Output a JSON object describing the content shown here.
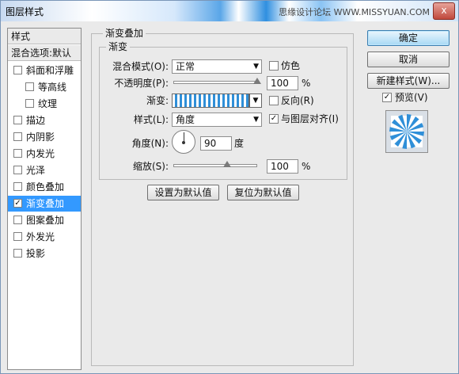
{
  "window": {
    "title": "图层样式",
    "watermark": "思缘设计论坛 WWW.MISSYUAN.COM",
    "close": "x"
  },
  "sidebar": {
    "header": "样式",
    "blend_options": "混合选项:默认",
    "items": [
      {
        "label": "斜面和浮雕",
        "checked": false,
        "indent": false,
        "selected": false
      },
      {
        "label": "等高线",
        "checked": false,
        "indent": true,
        "selected": false
      },
      {
        "label": "纹理",
        "checked": false,
        "indent": true,
        "selected": false
      },
      {
        "label": "描边",
        "checked": false,
        "indent": false,
        "selected": false
      },
      {
        "label": "内阴影",
        "checked": false,
        "indent": false,
        "selected": false
      },
      {
        "label": "内发光",
        "checked": false,
        "indent": false,
        "selected": false
      },
      {
        "label": "光泽",
        "checked": false,
        "indent": false,
        "selected": false
      },
      {
        "label": "颜色叠加",
        "checked": false,
        "indent": false,
        "selected": false
      },
      {
        "label": "渐变叠加",
        "checked": true,
        "indent": false,
        "selected": true
      },
      {
        "label": "图案叠加",
        "checked": false,
        "indent": false,
        "selected": false
      },
      {
        "label": "外发光",
        "checked": false,
        "indent": false,
        "selected": false
      },
      {
        "label": "投影",
        "checked": false,
        "indent": false,
        "selected": false
      }
    ]
  },
  "panel": {
    "outer_title": "渐变叠加",
    "inner_title": "渐变",
    "blend_mode_label": "混合模式(O):",
    "blend_mode_value": "正常",
    "dither_label": "仿色",
    "opacity_label": "不透明度(P):",
    "opacity_value": "100",
    "opacity_percent": 100,
    "gradient_label": "渐变:",
    "reverse_label": "反向(R)",
    "style_label": "样式(L):",
    "style_value": "角度",
    "align_label": "与图层对齐(I)",
    "angle_label": "角度(N):",
    "angle_value": "90",
    "angle_unit": "度",
    "scale_label": "缩放(S):",
    "scale_value": "100",
    "scale_percent": 100,
    "percent_unit": "%",
    "set_default": "设置为默认值",
    "reset_default": "复位为默认值"
  },
  "buttons": {
    "ok": "确定",
    "cancel": "取消",
    "new_style": "新建样式(W)...",
    "preview_label": "预览(V)"
  },
  "colors": {
    "accent": "#3399ff",
    "gradient_blue": "#2f8fd8"
  }
}
